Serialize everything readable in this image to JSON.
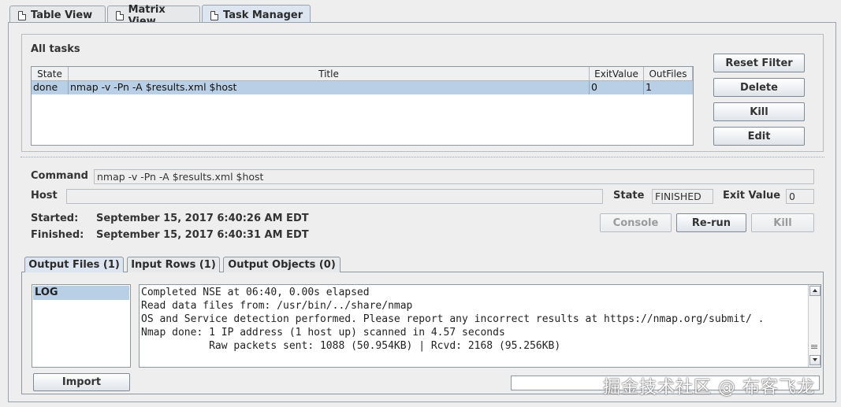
{
  "tabs": [
    {
      "label": "Table View",
      "active": false
    },
    {
      "label": "Matrix View",
      "active": false
    },
    {
      "label": "Task Manager",
      "active": true
    }
  ],
  "tasks_panel": {
    "title": "All tasks",
    "columns": [
      "State",
      "Title",
      "ExitValue",
      "OutFiles"
    ],
    "rows": [
      {
        "state": "done",
        "title": "nmap -v -Pn -A $results.xml $host",
        "exit_value": "0",
        "out_files": "1"
      }
    ]
  },
  "side_buttons": {
    "reset_filter": "Reset Filter",
    "delete": "Delete",
    "kill": "Kill",
    "edit": "Edit"
  },
  "detail": {
    "command_label": "Command",
    "command_value": "nmap -v -Pn -A $results.xml $host",
    "host_label": "Host",
    "host_value": "",
    "state_label": "State",
    "state_value": "FINISHED",
    "exit_value_label": "Exit Value",
    "exit_value": "0",
    "started_label": "Started:",
    "started_value": "September 15, 2017 6:40:26 AM EDT",
    "finished_label": "Finished:",
    "finished_value": "September 15, 2017 6:40:31 AM EDT",
    "console_button": "Console",
    "rerun_button": "Re-run",
    "kill_button": "Kill"
  },
  "output_tabs": [
    {
      "label": "Output Files (1)",
      "active": true
    },
    {
      "label": "Input Rows (1)",
      "active": false
    },
    {
      "label": "Output Objects (0)",
      "active": false
    }
  ],
  "files": {
    "items": [
      "LOG"
    ],
    "import_button": "Import"
  },
  "log_lines": [
    "Completed NSE at 06:40, 0.00s elapsed",
    "Read data files from: /usr/bin/../share/nmap",
    "OS and Service detection performed. Please report any incorrect results at https://nmap.org/submit/ .",
    "Nmap done: 1 IP address (1 host up) scanned in 4.57 seconds",
    "           Raw packets sent: 1088 (50.954KB) | Rcvd: 2168 (95.256KB)"
  ],
  "search_input_value": "",
  "watermark": "掘金技术社区 @ 布客飞龙",
  "colors": {
    "selection": "#b8cfe5",
    "background": "#eeeeee"
  }
}
